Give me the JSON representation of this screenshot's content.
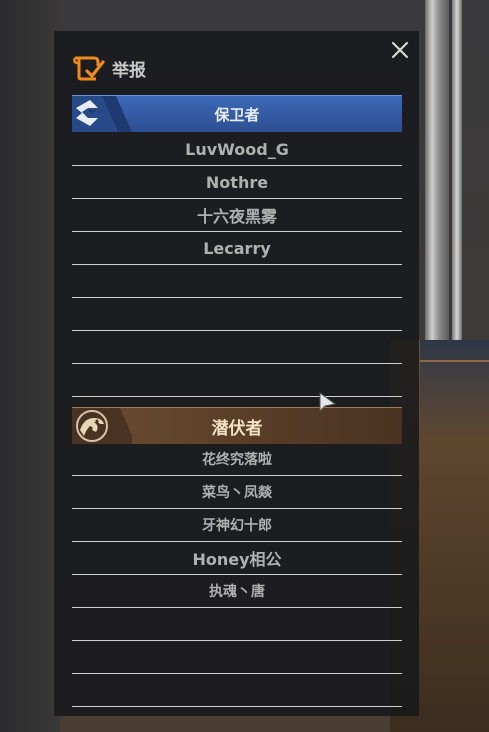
{
  "dialog": {
    "title": "举报",
    "close_icon": "close-icon",
    "report_icon": "report-flag-icon",
    "colors": {
      "accent_orange": "#f08a1c",
      "defender_blue": "#3c69b8",
      "lurker_brown": "#6b4d32"
    }
  },
  "teams": {
    "defender": {
      "name": "保卫者",
      "emblem": "defender-emblem-icon",
      "players": [
        "LuvWood_G",
        "Nothre",
        "十六夜黑雾",
        "Lecarry",
        "",
        "",
        "",
        ""
      ]
    },
    "lurker": {
      "name": "潜伏者",
      "emblem": "lurker-emblem-icon",
      "players": [
        "花终究落啦",
        "菜鸟丶凤燚",
        "牙神幻十郎",
        "Honey相公",
        "执魂丶唐",
        "",
        "",
        ""
      ]
    }
  }
}
